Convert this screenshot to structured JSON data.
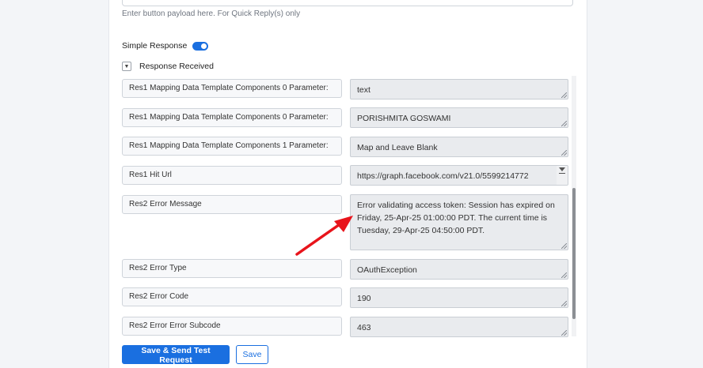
{
  "payload_hint": "Enter button payload here. For Quick Reply(s) only",
  "simple_response": {
    "label": "Simple Response",
    "enabled": true
  },
  "response_section": {
    "label": "Response Received",
    "icon": "chevron-down-icon"
  },
  "rows": [
    {
      "label": "Res1 Mapping Data Template Components 0 Parameter:",
      "value": "text"
    },
    {
      "label": "Res1 Mapping Data Template Components 0 Parameter:",
      "value": "PORISHMITA GOSWAMI"
    },
    {
      "label": "Res1 Mapping Data Template Components 1 Parameter:",
      "value": "Map and Leave Blank"
    },
    {
      "label": "Res1 Hit Url",
      "value": "https://graph.facebook.com/v21.0/5599214772"
    },
    {
      "label": "Res2 Error Message",
      "value": "Error validating access token: Session has expired on Friday, 25-Apr-25 01:00:00 PDT. The current time is Tuesday, 29-Apr-25 04:50:00 PDT."
    },
    {
      "label": "Res2 Error Type",
      "value": "OAuthException"
    },
    {
      "label": "Res2 Error Code",
      "value": "190"
    },
    {
      "label": "Res2 Error Error Subcode",
      "value": "463"
    }
  ],
  "buttons": {
    "save_send": "Save & Send Test Request",
    "save": "Save"
  },
  "colors": {
    "accent": "#1a6fe0",
    "annotation_arrow": "#e8141b"
  }
}
